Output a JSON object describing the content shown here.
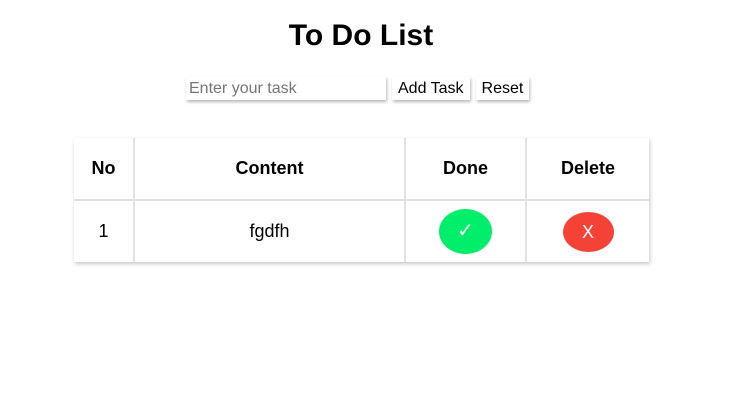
{
  "page": {
    "title": "To Do List"
  },
  "controls": {
    "input_placeholder": "Enter your task",
    "input_value": "",
    "add_label": "Add Task",
    "reset_label": "Reset"
  },
  "table": {
    "headers": {
      "no": "No",
      "content": "Content",
      "done": "Done",
      "delete": "Delete"
    },
    "rows": [
      {
        "no": "1",
        "content": "fgdfh",
        "done_symbol": "✓",
        "delete_symbol": "X"
      }
    ]
  },
  "colors": {
    "done_button": "#00ee6a",
    "delete_button": "#f44336",
    "divider": "#e2e2e2"
  },
  "icons": {
    "done": "checkmark-icon",
    "delete": "x-icon"
  }
}
